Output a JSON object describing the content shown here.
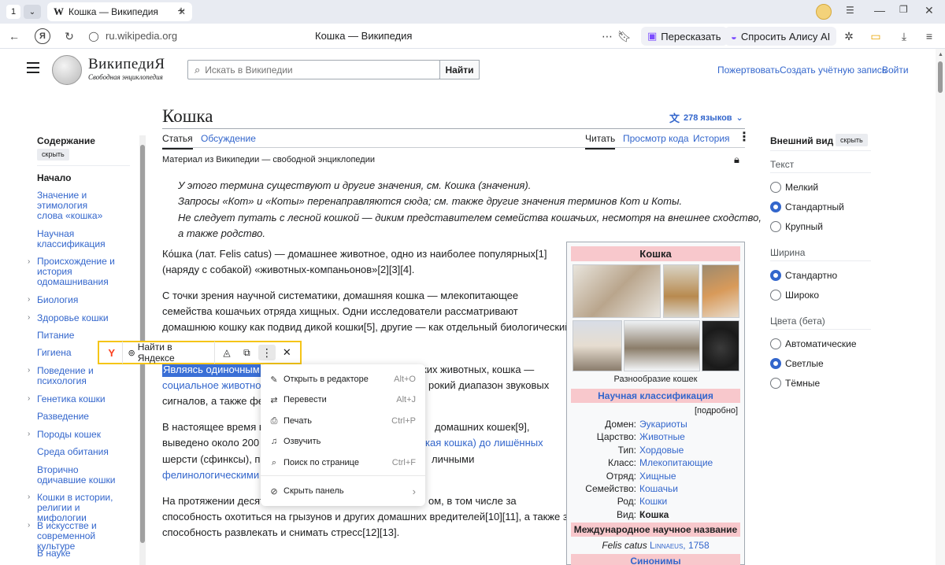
{
  "browser": {
    "tab_counter": "1",
    "tab_title": "Кошка — Википедия",
    "tab_favicon": "W",
    "url": "ru.wikipedia.org",
    "page_title": "Кошка — Википедия",
    "retell_label": "Пересказать",
    "alice_label": "Спросить Алису AI"
  },
  "wiki": {
    "logo_title": "ВикипедиЯ",
    "logo_subtitle": "Свободная энциклопедия",
    "search_placeholder": "Искать в Википедии",
    "search_button": "Найти",
    "top_links": [
      "Пожертвовать",
      "Создать учётную запись",
      "Войти"
    ]
  },
  "toc": {
    "title": "Содержание",
    "hide": "скрыть",
    "start": "Начало",
    "items": [
      "Значение и этимология слова «кошка»",
      "Научная классификация",
      "Происхождение и история одомашнивания",
      "Биология",
      "Здоровье кошки",
      "Питание",
      "Гигиена",
      "Поведение и психология",
      "Генетика кошки",
      "Разведение",
      "Породы кошек",
      "Среда обитания",
      "Вторично одичавшие кошки",
      "Кошки в истории, религии и мифологии",
      "В искусстве и современной культуре",
      "В науке"
    ]
  },
  "article": {
    "title": "Кошка",
    "languages": "278 языков",
    "tabs": [
      "Статья",
      "Обсуждение"
    ],
    "views": [
      "Читать",
      "Просмотр кода",
      "История"
    ],
    "tagline": "Материал из Википедии — свободной энциклопедии",
    "hatnotes": [
      "У этого термина существуют и другие значения, см. Кошка (значения).",
      "Запросы «Кот» и «Коты» перенаправляются сюда; см. также другие значения терминов Кот и Коты.",
      "Не следует путать с лесной кошкой — диким представителем семейства кошачьих, несмотря на внешнее сходство,",
      "а также родство."
    ],
    "p1": [
      "Ко́шка (лат. Felis catus) — домашнее животное, одно из наиболее популярных[1]",
      "(наряду с собакой) «животных-компаньонов»[2][3][4]."
    ],
    "p2": [
      "С точки зрения научной систематики, домашняя кошка — млекопитающее",
      "семейства кошачьих отряда хищных. Одни исследователи рассматривают",
      "домашнюю кошку как подвид дикой кошки[5], другие — как отдельный биологический"
    ],
    "p3": [
      "Являясь одиночным",
      "ких животных, кошка —",
      "социальное животно",
      "рокий диапазон звуковых",
      "сигналов, а также фе"
    ],
    "p4": [
      "В настоящее время в",
      "домашних кошек[9],",
      "выведено около 200",
      "кая кошка) до лишённых",
      "шерсти (сфинксы), пр",
      "личными",
      "фелинологическими"
    ],
    "p5": [
      "На протяжении десят",
      "ом, в том числе за",
      "способность охотиться на грызунов и других домашних вредителей[10][11], а также за",
      "способность развлекать и снимать стресс[12][13]."
    ]
  },
  "infobox": {
    "title": "Кошка",
    "caption": "Разнообразие кошек",
    "classification_header": "Научная классификация",
    "more": "[подробно]",
    "rows": [
      {
        "label": "Домен:",
        "value": "Эукариоты"
      },
      {
        "label": "Царство:",
        "value": "Животные"
      },
      {
        "label": "Тип:",
        "value": "Хордовые"
      },
      {
        "label": "Класс:",
        "value": "Млекопитающие"
      },
      {
        "label": "Отряд:",
        "value": "Хищные"
      },
      {
        "label": "Семейство:",
        "value": "Кошачьи"
      },
      {
        "label": "Род:",
        "value": "Кошки"
      },
      {
        "label": "Вид:",
        "value": "Кошка"
      }
    ],
    "intl_header": "Международное научное название",
    "latin": "Felis catus",
    "author": "Linnaeus, 1758",
    "synonyms_header": "Синонимы"
  },
  "appearance": {
    "title": "Внешний вид",
    "hide": "скрыть",
    "text_label": "Текст",
    "text_options": [
      "Мелкий",
      "Стандартный",
      "Крупный"
    ],
    "width_label": "Ширина",
    "width_options": [
      "Стандартно",
      "Широко"
    ],
    "color_label": "Цвета (бета)",
    "color_options": [
      "Автоматические",
      "Светлые",
      "Тёмные"
    ]
  },
  "selection_bar": {
    "logo": "Y",
    "find_label": "Найти в Яндексе",
    "selected_word": "Являясь"
  },
  "context_menu": {
    "items": [
      {
        "label": "Открыть в редакторе",
        "shortcut": "Alt+O"
      },
      {
        "label": "Перевести",
        "shortcut": "Alt+J"
      },
      {
        "label": "Печать",
        "shortcut": "Ctrl+P"
      },
      {
        "label": "Озвучить",
        "shortcut": ""
      },
      {
        "label": "Поиск по странице",
        "shortcut": "Ctrl+F"
      },
      {
        "label": "Скрыть панель",
        "shortcut": "›"
      }
    ]
  },
  "colors": {
    "link": "#3366cc",
    "highlight_border": "#f5c518",
    "infobox_header": "#f8c8cc",
    "selection": "#3a6fd6"
  }
}
